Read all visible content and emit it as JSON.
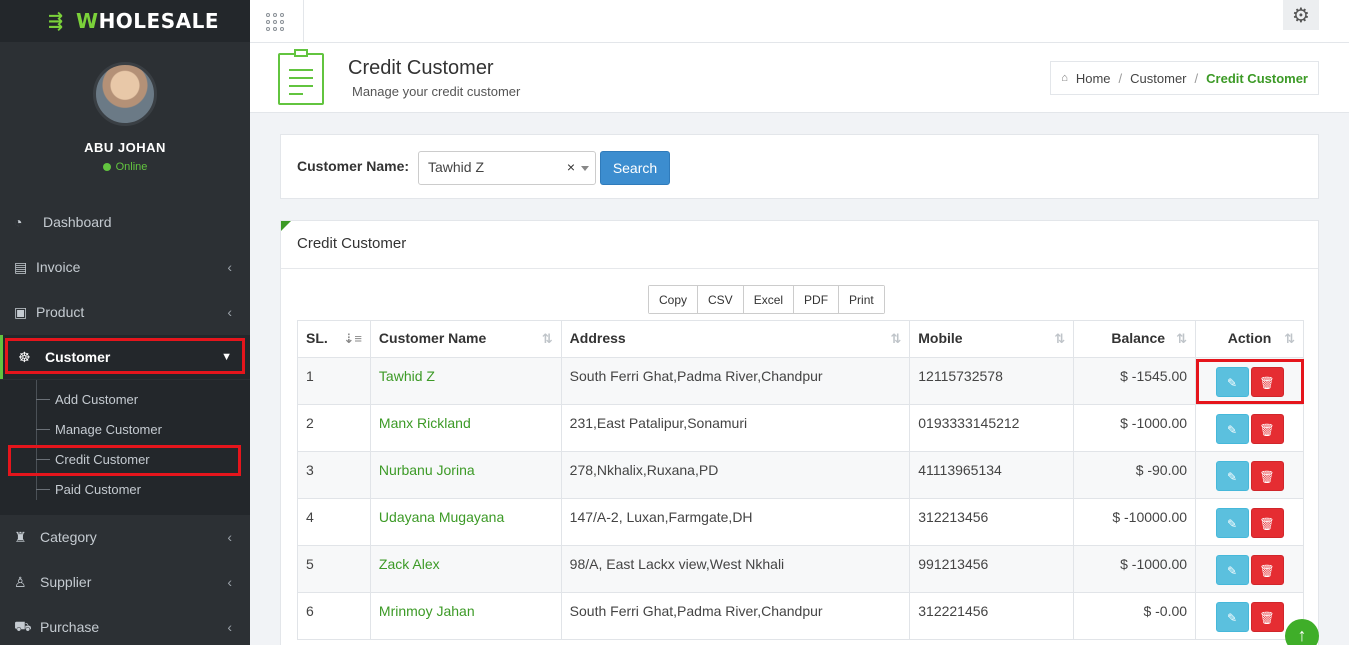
{
  "brand": {
    "name_prefix": "W",
    "name_rest": "HOLESALE",
    "accent": "#7bd13a"
  },
  "user": {
    "name": "ABU JOHAN",
    "status": "Online"
  },
  "nav": {
    "dashboard": "Dashboard",
    "invoice": "Invoice",
    "product": "Product",
    "customer": "Customer",
    "category": "Category",
    "supplier": "Supplier",
    "purchase": "Purchase",
    "submenu": {
      "add": "Add Customer",
      "manage": "Manage Customer",
      "credit": "Credit Customer",
      "paid": "Paid Customer"
    }
  },
  "header": {
    "title": "Credit Customer",
    "subtitle": "Manage your credit customer",
    "breadcrumb": {
      "home": "Home",
      "section": "Customer",
      "current": "Credit Customer"
    }
  },
  "search": {
    "label": "Customer Name:",
    "value": "Tawhid Z",
    "clear": "×",
    "button": "Search"
  },
  "table_panel": {
    "title": "Credit Customer",
    "export": {
      "copy": "Copy",
      "csv": "CSV",
      "excel": "Excel",
      "pdf": "PDF",
      "print": "Print"
    },
    "columns": {
      "sl": "SL.",
      "name": "Customer Name",
      "address": "Address",
      "mobile": "Mobile",
      "balance": "Balance",
      "action": "Action"
    },
    "rows": [
      {
        "sl": "1",
        "name": "Tawhid Z",
        "address": "South Ferri Ghat,Padma River,Chandpur",
        "mobile": "12115732578",
        "balance": "$ -1545.00"
      },
      {
        "sl": "2",
        "name": "Manx Rickland",
        "address": "231,East Patalipur,Sonamuri",
        "mobile": "0193333145212",
        "balance": "$ -1000.00"
      },
      {
        "sl": "3",
        "name": "Nurbanu Jorina",
        "address": "278,Nkhalix,Ruxana,PD",
        "mobile": "41113965134",
        "balance": "$ -90.00"
      },
      {
        "sl": "4",
        "name": "Udayana Mugayana",
        "address": "147/A-2, Luxan,Farmgate,DH",
        "mobile": "312213456",
        "balance": "$ -10000.00"
      },
      {
        "sl": "5",
        "name": "Zack Alex",
        "address": "98/A, East Lackx view,West Nkhali",
        "mobile": "991213456",
        "balance": "$ -1000.00"
      },
      {
        "sl": "6",
        "name": "Mrinmoy Jahan",
        "address": "South Ferri Ghat,Padma River,Chandpur",
        "mobile": "312221456",
        "balance": "$ -0.00"
      }
    ]
  },
  "icons": {
    "dashboard": "gauge-icon",
    "invoice": "invoice-icon",
    "product": "briefcase-icon",
    "customer": "handshake-icon",
    "category": "tag-icon",
    "supplier": "user-icon",
    "purchase": "cart-icon",
    "edit": "pencil-icon",
    "delete": "trash-icon",
    "settings": "gear-icon",
    "apps": "grid-icon",
    "scroll": "arrow-up-icon"
  },
  "colors": {
    "primary_green": "#3c9a26",
    "sidebar": "#2c3034",
    "search_button": "#3c8dcf",
    "edit": "#5bc0de",
    "delete": "#e52d32",
    "highlight": "#e5151c"
  }
}
